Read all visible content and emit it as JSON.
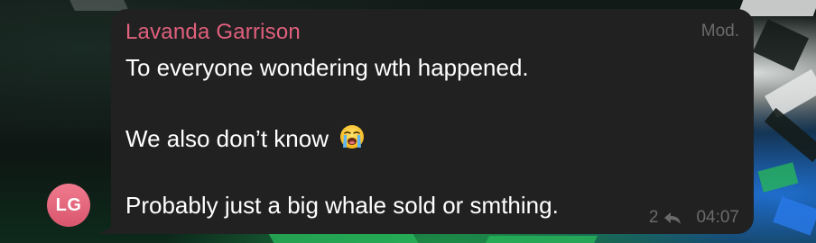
{
  "message": {
    "sender_name": "Lavanda Garrison",
    "sender_role": "Mod.",
    "lines": [
      "To everyone wondering wth happened.",
      "We also don’t know",
      "Probably just a big whale sold or smthing."
    ],
    "emoji": "crying-face-icon",
    "reply_count": "2",
    "time": "04:07"
  },
  "avatar": {
    "initials": "LG",
    "color": "#e0607d"
  },
  "colors": {
    "bubble": "#212121",
    "sender_name": "#e0607d",
    "meta": "#6a6a6a"
  }
}
